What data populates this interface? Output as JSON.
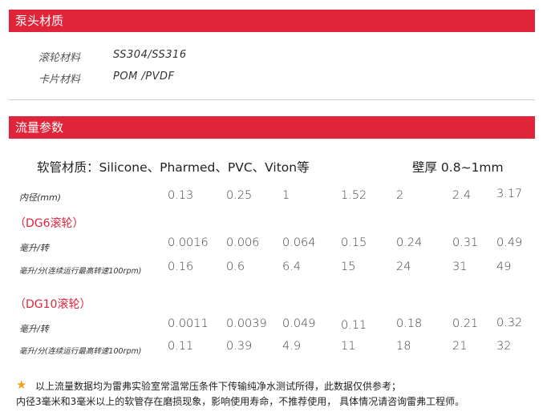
{
  "section1": {
    "title": "泵头材质",
    "materials": [
      {
        "label": "滚轮材料",
        "value": "SS304/SS316"
      },
      {
        "label": "卡片材料",
        "value": "POM /PVDF"
      }
    ]
  },
  "section2": {
    "title": "流量参数",
    "tube_material": "软管材质：Silicone、Pharmed、PVC、Viton等",
    "wall_thickness": "壁厚 0.8~1mm",
    "diameter_label": "内径(mm)",
    "diameters": [
      "0.13",
      "0.25",
      "1",
      "1.52",
      "2",
      "2.4",
      "3.17"
    ],
    "groups": [
      {
        "name": "（DG6滚轮）",
        "rows": [
          {
            "label": "毫升/转",
            "values": [
              "0.0016",
              "0.006",
              "0.064",
              "0.15",
              "0.24",
              "0.31",
              "0.49"
            ]
          },
          {
            "label": "毫升/分(连续运行最高转速100rpm)",
            "values": [
              "0.16",
              "0.6",
              "6.4",
              "15",
              "24",
              "31",
              "49"
            ]
          }
        ]
      },
      {
        "name": "（DG10滚轮）",
        "rows": [
          {
            "label": "毫升/转",
            "values": [
              "0.0011",
              "0.0039",
              "0.049",
              "0.11",
              "0.18",
              "0.21",
              "0.32"
            ]
          },
          {
            "label": "毫升/分(连续运行最高转速100rpm)",
            "values": [
              "0.11",
              "0.39",
              "4.9",
              "11",
              "18",
              "21",
              "32"
            ]
          }
        ]
      }
    ]
  },
  "notes": {
    "icon": "star-icon",
    "line1": "以上流量数据均为雷弗实验室常温常压条件下传输纯净水测试所得，此数据仅供参考；",
    "line2": "内径3毫米和3毫米以上的软管存在磨损现象，影响使用寿命，不推荐使用， 具体情况请咨询雷弗工程师。"
  },
  "colors": {
    "accent": "#e0243a",
    "star": "#f0a020"
  }
}
